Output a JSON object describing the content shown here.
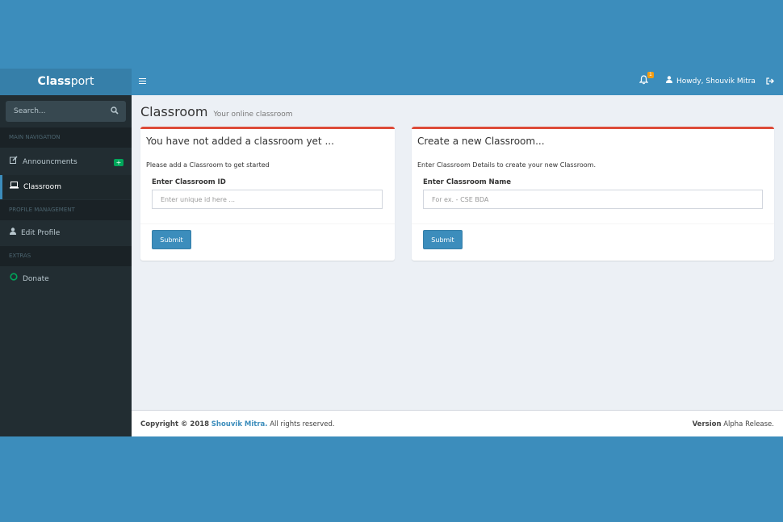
{
  "header": {
    "logo_bold": "Class",
    "logo_thin": "port",
    "notification_count": "1",
    "user_greeting": "Howdy, Shouvik Mitra",
    "icons": {
      "menu": "hamburger-icon",
      "notifications": "bell-icon",
      "user": "user-icon",
      "signout": "sign-out-icon"
    }
  },
  "sidebar": {
    "search_placeholder": "Search...",
    "sections": [
      {
        "header": "MAIN NAVIGATION",
        "items": [
          {
            "label": "Announcments",
            "icon": "edit-icon",
            "badge": "+"
          },
          {
            "label": "Classroom",
            "icon": "laptop-icon",
            "active": true
          }
        ]
      },
      {
        "header": "PROFILE MANAGEMENT",
        "items": [
          {
            "label": "Edit Profile",
            "icon": "user-icon"
          }
        ]
      },
      {
        "header": "EXTRAS",
        "items": [
          {
            "label": "Donate",
            "icon": "circle-icon"
          }
        ]
      }
    ]
  },
  "page": {
    "title": "Classroom",
    "subtitle": "Your online classroom"
  },
  "boxes": [
    {
      "title": "You have not added a classroom yet ...",
      "description": "Please add a Classroom to get started",
      "field_label": "Enter Classroom ID",
      "placeholder": "Enter unique id here ...",
      "button": "Submit"
    },
    {
      "title": "Create a new Classroom...",
      "description": "Enter Classroom Details to create your new Classroom.",
      "field_label": "Enter Classroom Name",
      "placeholder": "For ex. - CSE BDA",
      "button": "Submit"
    }
  ],
  "footer": {
    "copyright_prefix": "Copyright © 2018",
    "author": "Shouvik Mitra.",
    "rights": "All rights reserved.",
    "version_label": "Version",
    "version_value": "Alpha Release."
  },
  "colors": {
    "brand": "#3c8dbc",
    "sidebar": "#222d32",
    "accent_red": "#dd4b39",
    "badge_green": "#00a65a",
    "notify_orange": "#f39c12"
  }
}
